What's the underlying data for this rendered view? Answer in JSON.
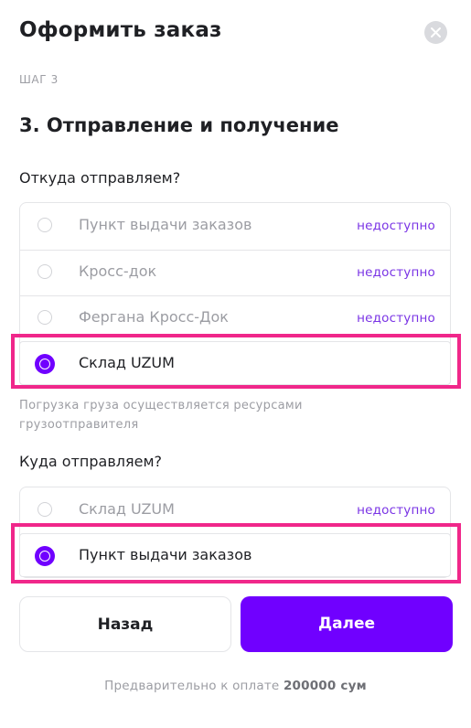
{
  "header": {
    "title": "Оформить заказ"
  },
  "step": {
    "label": "ШАГ 3",
    "title": "3. Отправление и получение"
  },
  "origin": {
    "question": "Откуда отправляем?",
    "options": [
      {
        "label": "Пункт выдачи заказов",
        "badge": "недоступно",
        "selected": false
      },
      {
        "label": "Кросс-док",
        "badge": "недоступно",
        "selected": false
      },
      {
        "label": "Фергана Кросс-Док",
        "badge": "недоступно",
        "selected": false
      },
      {
        "label": "Склад UZUM",
        "badge": "",
        "selected": true
      }
    ],
    "note": "Погрузка груза осуществляется ресурсами грузоотправителя"
  },
  "destination": {
    "question": "Куда отправляем?",
    "options": [
      {
        "label": "Склад UZUM",
        "badge": "недоступно",
        "selected": false
      },
      {
        "label": "Пункт выдачи заказов",
        "badge": "",
        "selected": true
      }
    ]
  },
  "buttons": {
    "back": "Назад",
    "next": "Далее"
  },
  "footer": {
    "prepay_label": "Предварительно к оплате",
    "prepay_amount": "200000 сум"
  },
  "colors": {
    "accent": "#7000ff",
    "badge": "#7a34e5",
    "highlight": "#f0278a"
  }
}
